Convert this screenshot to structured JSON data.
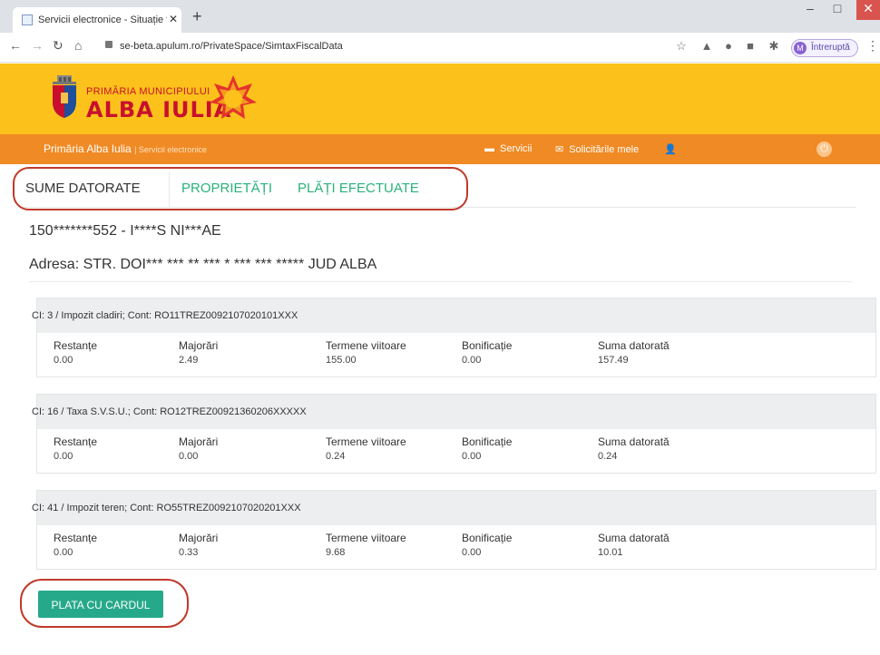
{
  "browser": {
    "tab_title": "Servicii electronice - Situație fisca",
    "url": "se-beta.apulum.ro/PrivateSpace/SimtaxFiscalData",
    "profile_initial": "M",
    "profile_status": "Întreruptă"
  },
  "header": {
    "logo_small": "PRIMĂRIA MUNICIPIULUI",
    "logo_big": "ALBA IULIA"
  },
  "nav": {
    "brand": "Primăria Alba Iulia",
    "brand_sub": "| Servicii electronice",
    "servicii": "Servicii",
    "solicitari": "Solicitările mele"
  },
  "tabs": [
    "SUME DATORATE",
    "PROPRIETĂȚI",
    "PLĂȚI EFECTUATE"
  ],
  "person": "150*******552 - I****S NI***AE",
  "address": "Adresa: STR. DOI*** *** ** *** * *** *** ***** JUD ALBA",
  "columns": [
    "Restanțe",
    "Majorări",
    "Termene viitoare",
    "Bonificație",
    "Suma datorată"
  ],
  "cards": [
    {
      "title": "CI: 3 / Impozit cladiri; Cont: RO11TREZ0092107020101XXX",
      "values": [
        "0.00",
        "2.49",
        "155.00",
        "0.00",
        "157.49"
      ]
    },
    {
      "title": "CI: 16 / Taxa S.V.S.U.; Cont: RO12TREZ00921360206XXXXX",
      "values": [
        "0.00",
        "0.00",
        "0.24",
        "0.00",
        "0.24"
      ]
    },
    {
      "title": "CI: 41 / Impozit teren; Cont: RO55TREZ0092107020201XXX",
      "values": [
        "0.00",
        "0.33",
        "9.68",
        "0.00",
        "10.01"
      ]
    }
  ],
  "pay_button": "PLATA CU CARDUL",
  "colors": {
    "header_yellow": "#fcc21b",
    "nav_orange": "#f08a24",
    "accent_green": "#26a98a",
    "highlight_red": "#c0392b"
  }
}
